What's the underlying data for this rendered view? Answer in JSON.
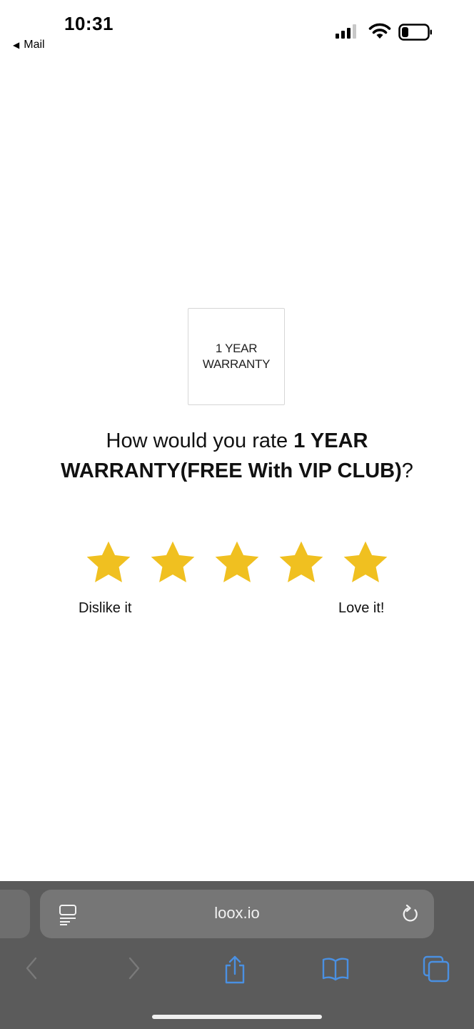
{
  "status_bar": {
    "time": "10:31",
    "back_app": "Mail"
  },
  "product": {
    "image_text_line1": "1 YEAR",
    "image_text_line2": "WARRANTY"
  },
  "question": {
    "prefix": "How would you rate ",
    "product_name": "1 YEAR WARRANTY(FREE With VIP CLUB)",
    "suffix": "?"
  },
  "rating": {
    "stars_count": 5,
    "star_color": "#F0C020",
    "low_label": "Dislike it",
    "high_label": "Love it!"
  },
  "browser": {
    "url": "loox.io",
    "accent": "#4A90E2",
    "toolbar_icons": [
      "back-icon",
      "forward-icon",
      "share-icon",
      "bookmarks-icon",
      "tabs-icon"
    ]
  }
}
